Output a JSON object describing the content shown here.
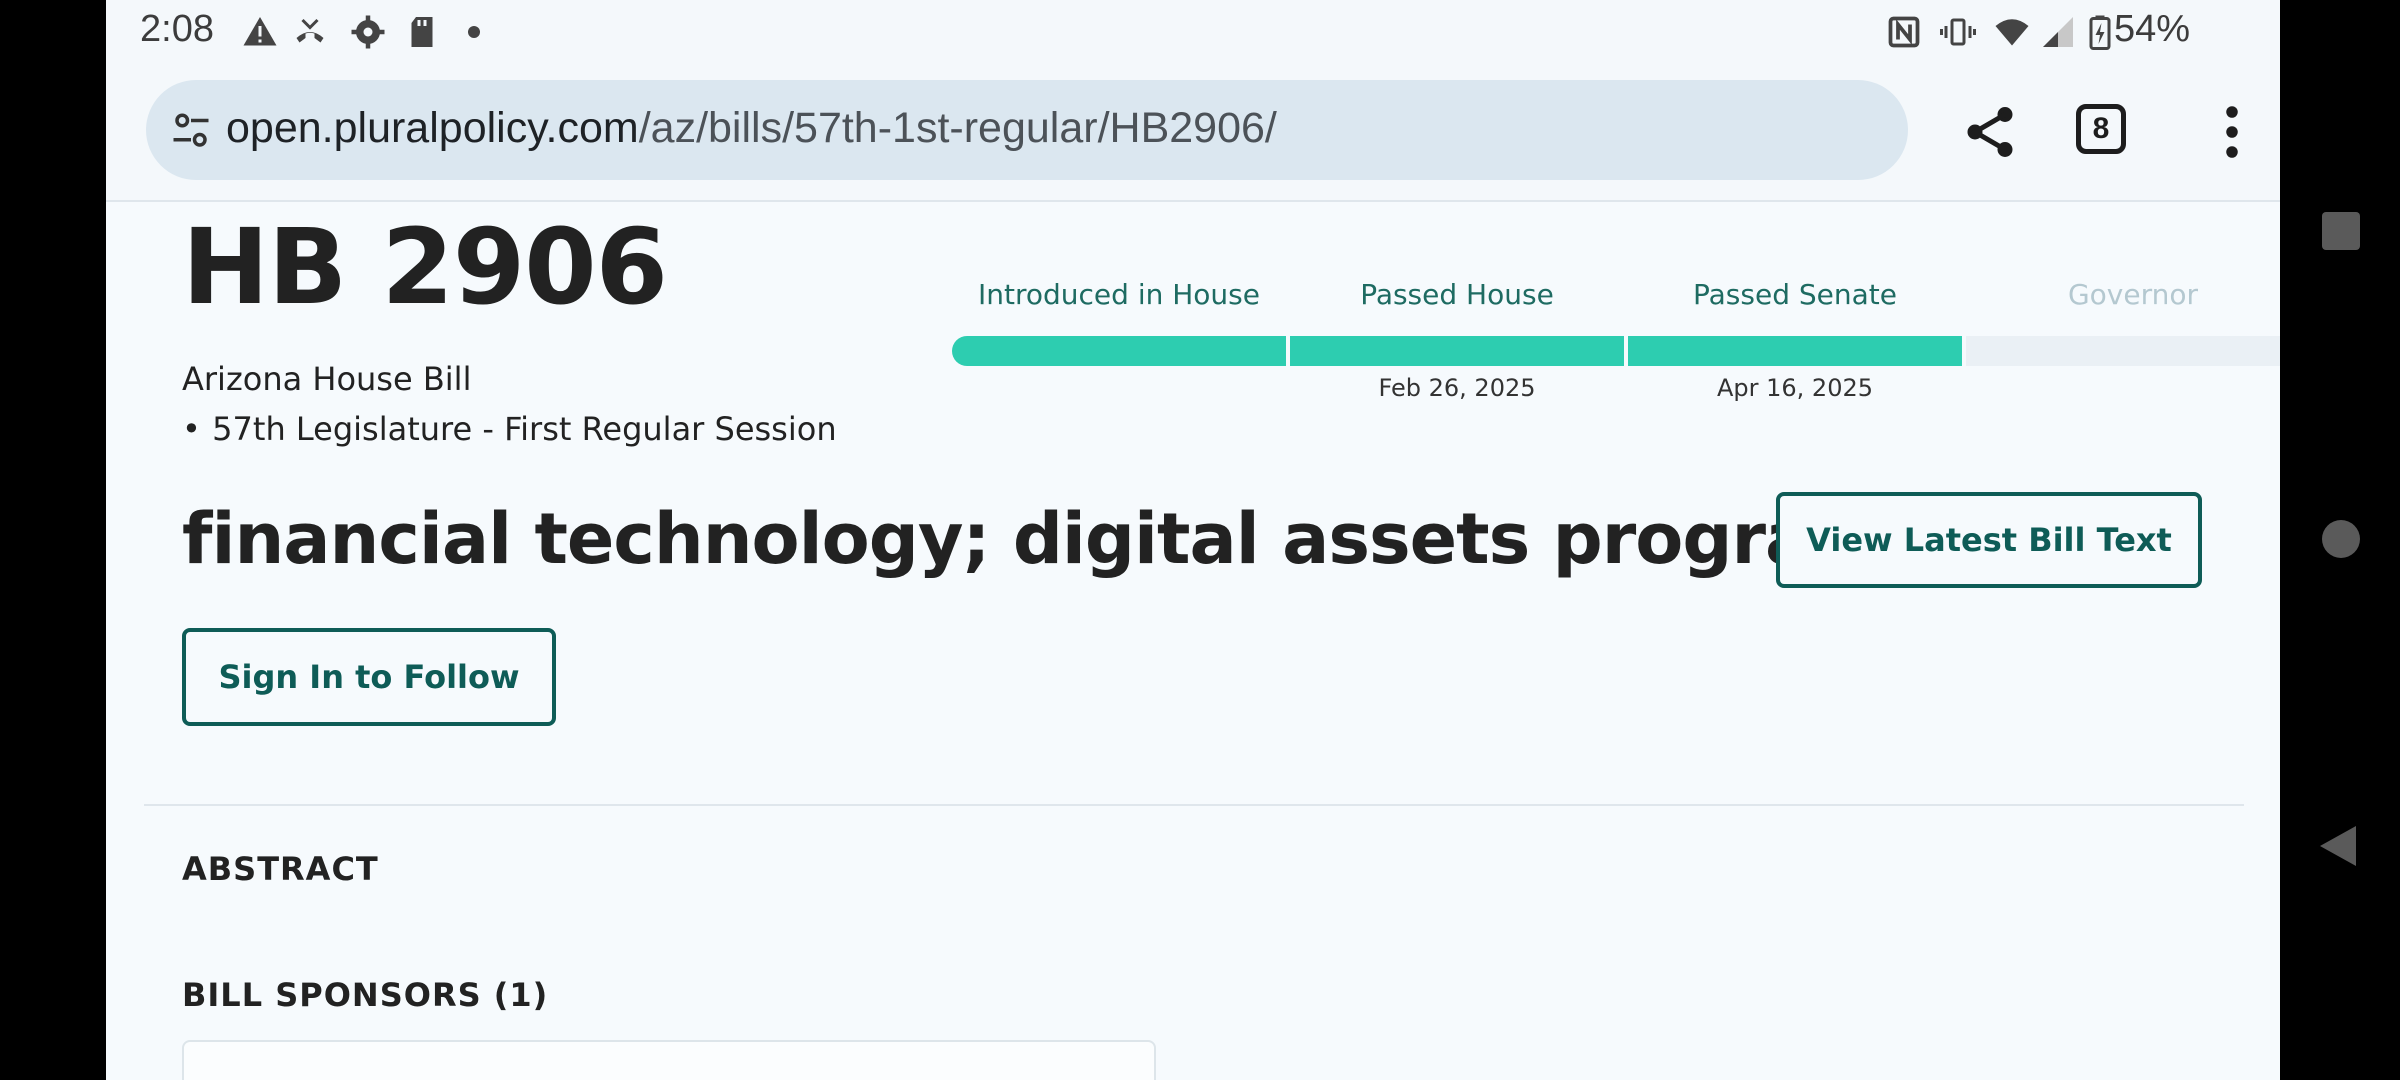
{
  "status_bar": {
    "time": "2:08",
    "battery": "54%",
    "icons": [
      "warning-icon",
      "missed-call-icon",
      "settings-icon",
      "sd-card-icon",
      "dot-icon",
      "nfc-icon",
      "vibrate-icon",
      "wifi-icon",
      "signal-icon",
      "battery-icon"
    ]
  },
  "browser": {
    "url_domain": "open.pluralpolicy.com",
    "url_path": "/az/bills/57th-1st-regular/HB2906/",
    "tab_count": "8",
    "icons": [
      "site-settings-icon",
      "share-icon",
      "tab-switcher-icon",
      "more-menu-icon"
    ]
  },
  "bill": {
    "identifier": "HB 2906",
    "chamber_type": "Arizona House Bill",
    "session": "57th Legislature - First Regular Session",
    "title": "financial technology; digital assets program",
    "view_text_label": "View Latest Bill Text",
    "follow_label": "Sign In to Follow"
  },
  "progress": {
    "steps": [
      {
        "label": "Introduced in House",
        "date": "",
        "status": "complete"
      },
      {
        "label": "Passed House",
        "date": "Feb 26, 2025",
        "status": "complete"
      },
      {
        "label": "Passed Senate",
        "date": "Apr 16, 2025",
        "status": "complete"
      },
      {
        "label": "Governor",
        "date": "",
        "status": "pending"
      }
    ],
    "colors": {
      "complete": "#2dcdb0",
      "pending": "#eaf0f5"
    }
  },
  "sections": {
    "abstract": "ABSTRACT",
    "sponsors": "BILL SPONSORS (1)"
  },
  "colors": {
    "accent": "#0e5c57",
    "progress_fill": "#2dcdb0"
  }
}
